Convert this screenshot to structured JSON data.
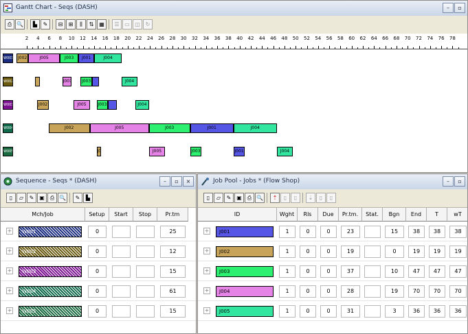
{
  "colors": {
    "J001": "#5555e6",
    "J002": "#c8a45a",
    "J003": "#2ef070",
    "J004": "#e683e6",
    "J005": "#33e6a0"
  },
  "gantt_window": {
    "title": "Gantt Chart - Seqs (DASH)",
    "ruler_ticks": [
      "2",
      "4",
      "6",
      "8",
      "10",
      "12",
      "14",
      "16",
      "18",
      "20",
      "22",
      "24",
      "26",
      "28",
      "30",
      "32",
      "34",
      "36",
      "38",
      "40",
      "42",
      "44",
      "46",
      "48",
      "50",
      "52",
      "54",
      "56",
      "58",
      "60",
      "62",
      "64",
      "66",
      "68",
      "70",
      "72",
      "74",
      "76",
      "78"
    ],
    "machines": [
      {
        "label": "W001",
        "color": "#1a2c80",
        "bars": [
          {
            "label": "J002",
            "job": "J002",
            "start": 1,
            "end": 6
          },
          {
            "label": "J005",
            "job": "J004",
            "start": 6,
            "end": 20
          },
          {
            "label": "J003",
            "job": "J003",
            "start": 20,
            "end": 28
          },
          {
            "label": "J001",
            "job": "J001",
            "start": 28,
            "end": 35
          },
          {
            "label": "J004",
            "job": "J005",
            "start": 35,
            "end": 47
          }
        ]
      },
      {
        "label": "W002",
        "color": "#6a5a10",
        "bars": [
          {
            "label": "",
            "job": "J002",
            "start": 9,
            "end": 11
          },
          {
            "label": "J001",
            "job": "J004",
            "start": 21,
            "end": 25
          },
          {
            "label": "J003",
            "job": "J003",
            "start": 29,
            "end": 34
          },
          {
            "label": "",
            "job": "J001",
            "start": 34,
            "end": 37
          },
          {
            "label": "J004",
            "job": "J005",
            "start": 47,
            "end": 54
          }
        ]
      },
      {
        "label": "W003",
        "color": "#7a1090",
        "bars": [
          {
            "label": "J002",
            "job": "J002",
            "start": 10,
            "end": 15
          },
          {
            "label": "J005",
            "job": "J004",
            "start": 26,
            "end": 33
          },
          {
            "label": "J003",
            "job": "J003",
            "start": 36,
            "end": 41
          },
          {
            "label": "",
            "job": "J001",
            "start": 41,
            "end": 45
          },
          {
            "label": "J004",
            "job": "J005",
            "start": 53,
            "end": 59
          }
        ]
      },
      {
        "label": "W004",
        "color": "#0e6a4a",
        "bars": [
          {
            "label": "J002",
            "job": "J002",
            "start": 15,
            "end": 33
          },
          {
            "label": "J005",
            "job": "J004",
            "start": 33,
            "end": 59
          },
          {
            "label": "J003",
            "job": "J003",
            "start": 59,
            "end": 77
          },
          {
            "label": "J001",
            "job": "J001",
            "start": 77,
            "end": 96
          },
          {
            "label": "J004",
            "job": "J005",
            "start": 96,
            "end": 115
          }
        ]
      },
      {
        "label": "W005",
        "color": "#1a6a40",
        "bars": [
          {
            "label": "J002",
            "job": "J002",
            "start": 36,
            "end": 38
          },
          {
            "label": "J005",
            "job": "J004",
            "start": 59,
            "end": 66
          },
          {
            "label": "J003",
            "job": "J003",
            "start": 77,
            "end": 82
          },
          {
            "label": "J001",
            "job": "J001",
            "start": 96,
            "end": 101
          },
          {
            "label": "J004",
            "job": "J005",
            "start": 115,
            "end": 122
          }
        ]
      }
    ]
  },
  "sequence_window": {
    "title": "Sequence - Seqs * (DASH)",
    "columns": [
      "Mch/Job",
      "Setup",
      "Start",
      "Stop",
      "Pr.tm"
    ],
    "rows": [
      {
        "label": "W001",
        "setup": "0",
        "start": "",
        "stop": "",
        "prtm": "25",
        "color": "#1a2c80"
      },
      {
        "label": "W002",
        "setup": "0",
        "start": "",
        "stop": "",
        "prtm": "12",
        "color": "#6a5a10"
      },
      {
        "label": "W003",
        "setup": "0",
        "start": "",
        "stop": "",
        "prtm": "15",
        "color": "#7a1090"
      },
      {
        "label": "W004",
        "setup": "0",
        "start": "",
        "stop": "",
        "prtm": "61",
        "color": "#0e6a4a"
      },
      {
        "label": "W005",
        "setup": "0",
        "start": "",
        "stop": "",
        "prtm": "15",
        "color": "#1a6a40"
      }
    ]
  },
  "jobpool_window": {
    "title": "Job Pool - Jobs * (Flow Shop)",
    "columns": [
      "ID",
      "Wght",
      "Rls",
      "Due",
      "Pr.tm.",
      "Stat.",
      "Bgn",
      "End",
      "T",
      "wT"
    ],
    "rows": [
      {
        "id": "J001",
        "job": "J001",
        "wght": "1",
        "rls": "0",
        "due": "0",
        "prtm": "23",
        "stat": "",
        "bgn": "15",
        "end": "38",
        "t": "38",
        "wt": "38"
      },
      {
        "id": "J002",
        "job": "J002",
        "wght": "1",
        "rls": "0",
        "due": "0",
        "prtm": "19",
        "stat": "",
        "bgn": "0",
        "end": "19",
        "t": "19",
        "wt": "19"
      },
      {
        "id": "J003",
        "job": "J003",
        "wght": "1",
        "rls": "0",
        "due": "0",
        "prtm": "37",
        "stat": "",
        "bgn": "10",
        "end": "47",
        "t": "47",
        "wt": "47"
      },
      {
        "id": "J004",
        "job": "J004",
        "wght": "1",
        "rls": "0",
        "due": "0",
        "prtm": "28",
        "stat": "",
        "bgn": "19",
        "end": "70",
        "t": "70",
        "wt": "70"
      },
      {
        "id": "J005",
        "job": "J005",
        "wght": "1",
        "rls": "0",
        "due": "0",
        "prtm": "31",
        "stat": "",
        "bgn": "3",
        "end": "36",
        "t": "36",
        "wt": "36"
      }
    ]
  }
}
